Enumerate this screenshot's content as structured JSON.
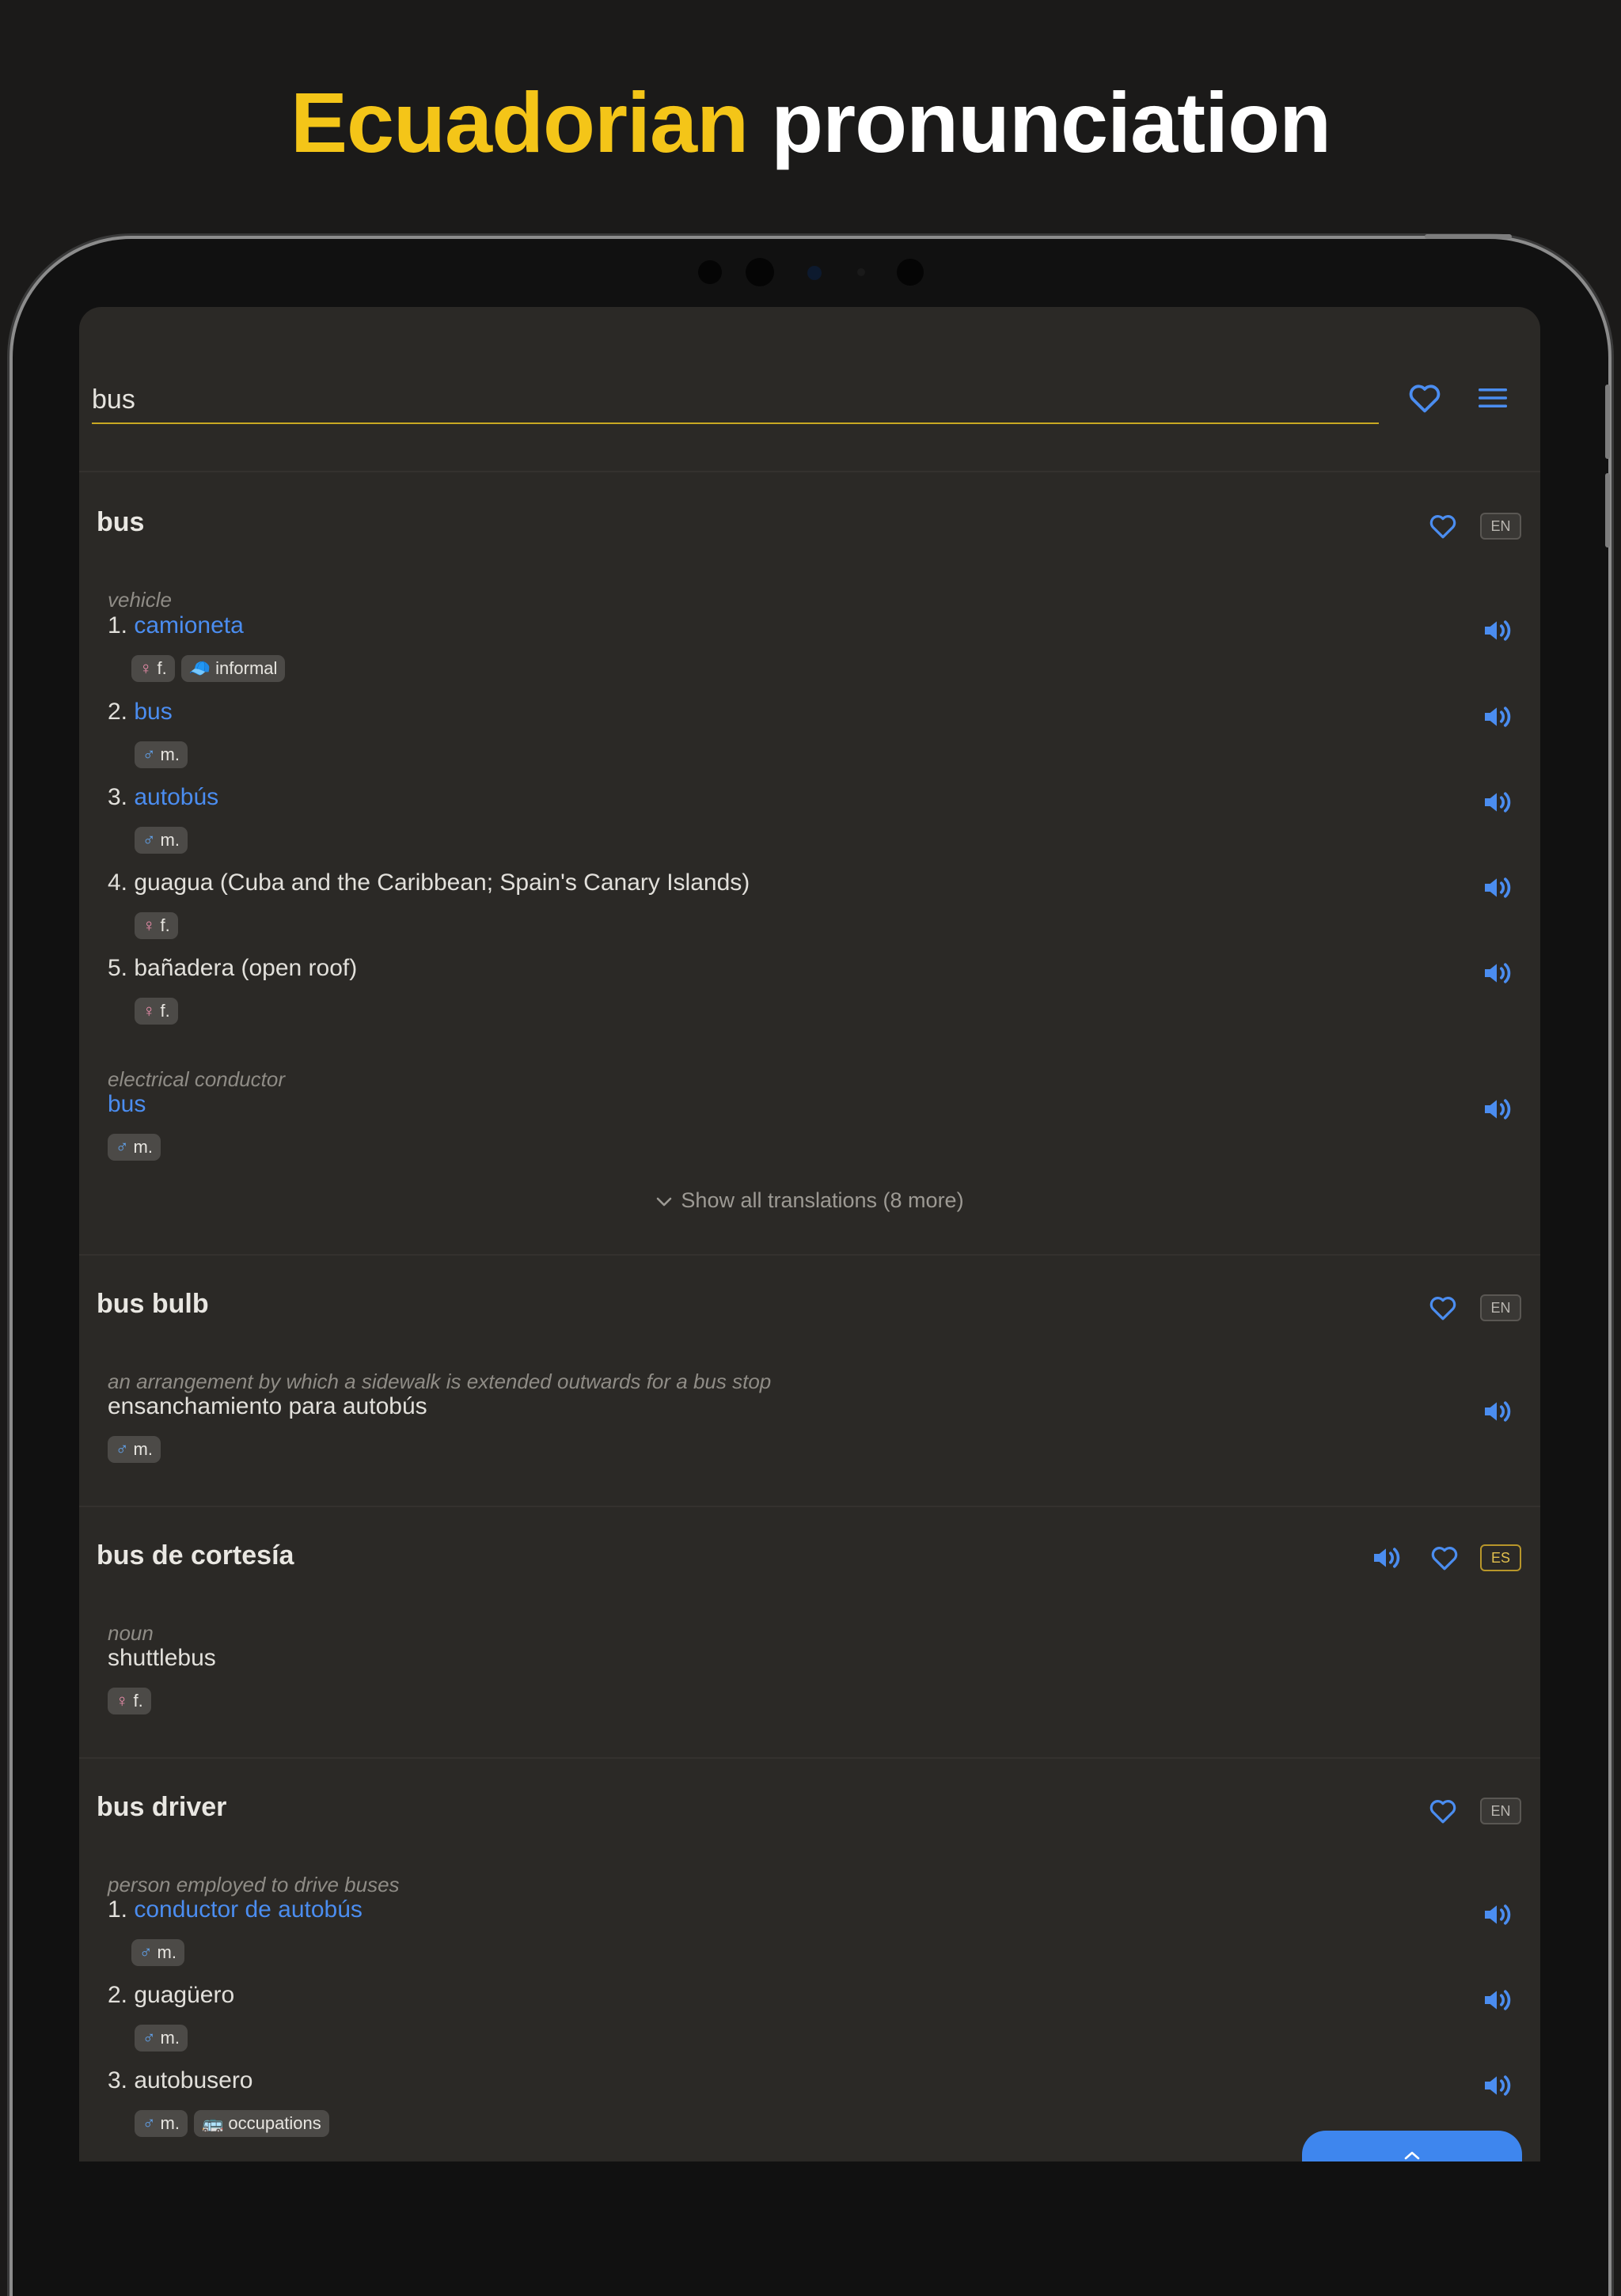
{
  "headline": {
    "accent": "Ecuadorian",
    "rest": "pronunciation"
  },
  "search": {
    "value": "bus"
  },
  "icons": {
    "favorites": "heart-icon",
    "menu": "hamburger-menu-icon",
    "audio": "speaker-icon",
    "expand": "chevron-down-icon",
    "fab": "chevron-up-icon"
  },
  "colors": {
    "accent_yellow": "#f4c518",
    "link_blue": "#4b8df0",
    "background": "#2b2926",
    "tag_bg": "#4c4a47"
  },
  "entries": [
    {
      "headword": "bus",
      "lang": "EN",
      "groups": [
        {
          "sense": "vehicle",
          "translations": [
            {
              "num": "1.",
              "text": "camioneta",
              "tags": [
                {
                  "sym": "♀",
                  "label": "f."
                },
                {
                  "sym": "🧢",
                  "label": "informal"
                }
              ]
            },
            {
              "num": "2.",
              "text": "bus",
              "tags": [
                {
                  "sym": "♂",
                  "label": "m."
                }
              ]
            },
            {
              "num": "3.",
              "text": "autobús",
              "tags": [
                {
                  "sym": "♂",
                  "label": "m."
                }
              ]
            },
            {
              "num": "4.",
              "text": "guagua (Cuba and the Caribbean; Spain's Canary Islands)",
              "tags": [
                {
                  "sym": "♀",
                  "label": "f."
                }
              ]
            },
            {
              "num": "5.",
              "text": "bañadera (open roof)",
              "tags": [
                {
                  "sym": "♀",
                  "label": "f."
                }
              ]
            }
          ]
        },
        {
          "sense": "electrical conductor",
          "translations": [
            {
              "num": "",
              "text": "bus",
              "tags": [
                {
                  "sym": "♂",
                  "label": "m."
                }
              ]
            }
          ]
        }
      ],
      "show_more": "Show all translations (8 more)"
    },
    {
      "headword": "bus bulb",
      "lang": "EN",
      "sense": "an arrangement by which a sidewalk is extended outwards for a bus stop",
      "translation": "ensanchamiento para autobús",
      "tag": {
        "sym": "♂",
        "label": "m."
      }
    },
    {
      "headword": "bus de cortesía",
      "lang": "ES",
      "sense": "noun",
      "translation": "shuttlebus",
      "tag": {
        "sym": "♀",
        "label": "f."
      }
    },
    {
      "headword": "bus driver",
      "lang": "EN",
      "sense": "person employed to drive buses",
      "translations": [
        {
          "num": "1.",
          "text": "conductor de autobús",
          "tags": [
            {
              "sym": "♂",
              "label": "m."
            }
          ]
        },
        {
          "num": "2.",
          "text": "guagüero",
          "tags": [
            {
              "sym": "♂",
              "label": "m."
            }
          ]
        },
        {
          "num": "3.",
          "text": "autobusero",
          "tags": [
            {
              "sym": "♂",
              "label": "m."
            },
            {
              "sym": "🚌",
              "label": "occupations"
            }
          ]
        }
      ]
    }
  ]
}
